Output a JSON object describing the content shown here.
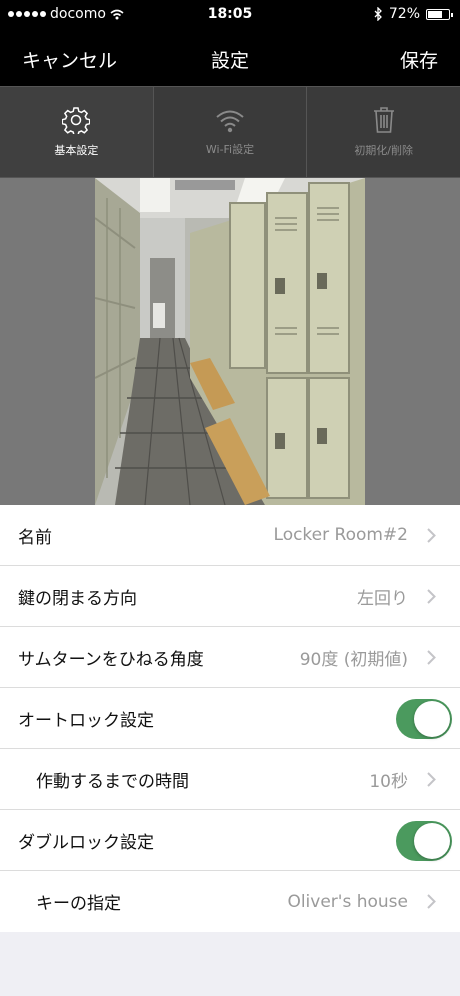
{
  "status_bar": {
    "carrier": "docomo",
    "time": "18:05",
    "battery": "72%",
    "battery_level": 0.72
  },
  "nav": {
    "cancel_label": "キャンセル",
    "title": "設定",
    "save_label": "保存"
  },
  "tabs": [
    {
      "label": "基本設定",
      "icon": "gear-icon",
      "active": true
    },
    {
      "label": "Wi-Fi設定",
      "icon": "wifi-icon",
      "active": false
    },
    {
      "label": "初期化/削除",
      "icon": "trash-icon",
      "active": false
    }
  ],
  "photo": {
    "description_icon": "camera-icon"
  },
  "settings": [
    {
      "label": "名前",
      "value": "Locker Room#2",
      "type": "disclosure"
    },
    {
      "label": "鍵の閉まる方向",
      "value": "左回り",
      "type": "disclosure"
    },
    {
      "label": "サムターンをひねる角度",
      "value": "90度 (初期値)",
      "type": "disclosure"
    },
    {
      "label": "オートロック設定",
      "type": "toggle",
      "on": true
    },
    {
      "label": "作動するまでの時間",
      "value": "10秒",
      "type": "disclosure",
      "sub": true
    },
    {
      "label": "ダブルロック設定",
      "type": "toggle",
      "on": true
    },
    {
      "label": "キーの指定",
      "value": "Oliver's house",
      "type": "disclosure",
      "sub": true
    }
  ],
  "colors": {
    "toggle_on": "#4b9a5e",
    "nav_background": "#000000",
    "tab_background": "#3a3a3a"
  }
}
